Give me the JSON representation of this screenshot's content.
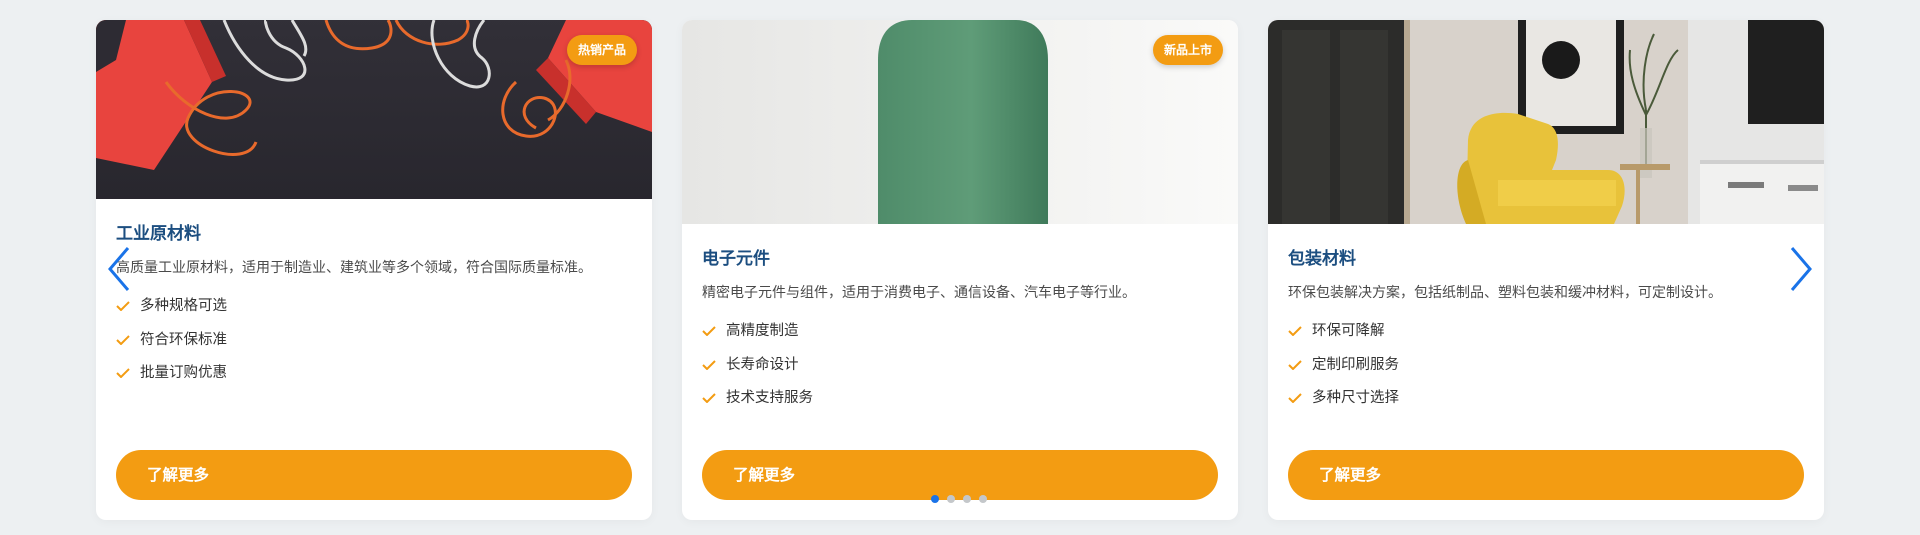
{
  "carousel": {
    "cards": [
      {
        "badge": "热销产品",
        "title": "工业原材料",
        "description": "高质量工业原材料，适用于制造业、建筑业等多个领域，符合国际质量标准。",
        "features": [
          "多种规格可选",
          "符合环保标准",
          "批量订购优惠"
        ],
        "button": "了解更多",
        "image": "shopping-bags-photo"
      },
      {
        "badge": "新品上市",
        "title": "电子元件",
        "description": "精密电子元件与组件，适用于消费电子、通信设备、汽车电子等行业。",
        "features": [
          "高精度制造",
          "长寿命设计",
          "技术支持服务"
        ],
        "button": "了解更多",
        "image": "green-bottle-photo"
      },
      {
        "badge": "",
        "title": "包装材料",
        "description": "环保包装解决方案，包括纸制品、塑料包装和缓冲材料，可定制设计。",
        "features": [
          "环保可降解",
          "定制印刷服务",
          "多种尺寸选择"
        ],
        "button": "了解更多",
        "image": "yellow-armchair-room-photo"
      }
    ],
    "pagination": {
      "total": 4,
      "active_index": 0
    },
    "icons": {
      "prev": "chevron-left-icon",
      "next": "chevron-right-icon",
      "feature": "check-icon"
    }
  },
  "colors": {
    "accent": "#f39c12",
    "title": "#1c4e80",
    "nav": "#1a73e8",
    "background": "#edf0f2"
  }
}
